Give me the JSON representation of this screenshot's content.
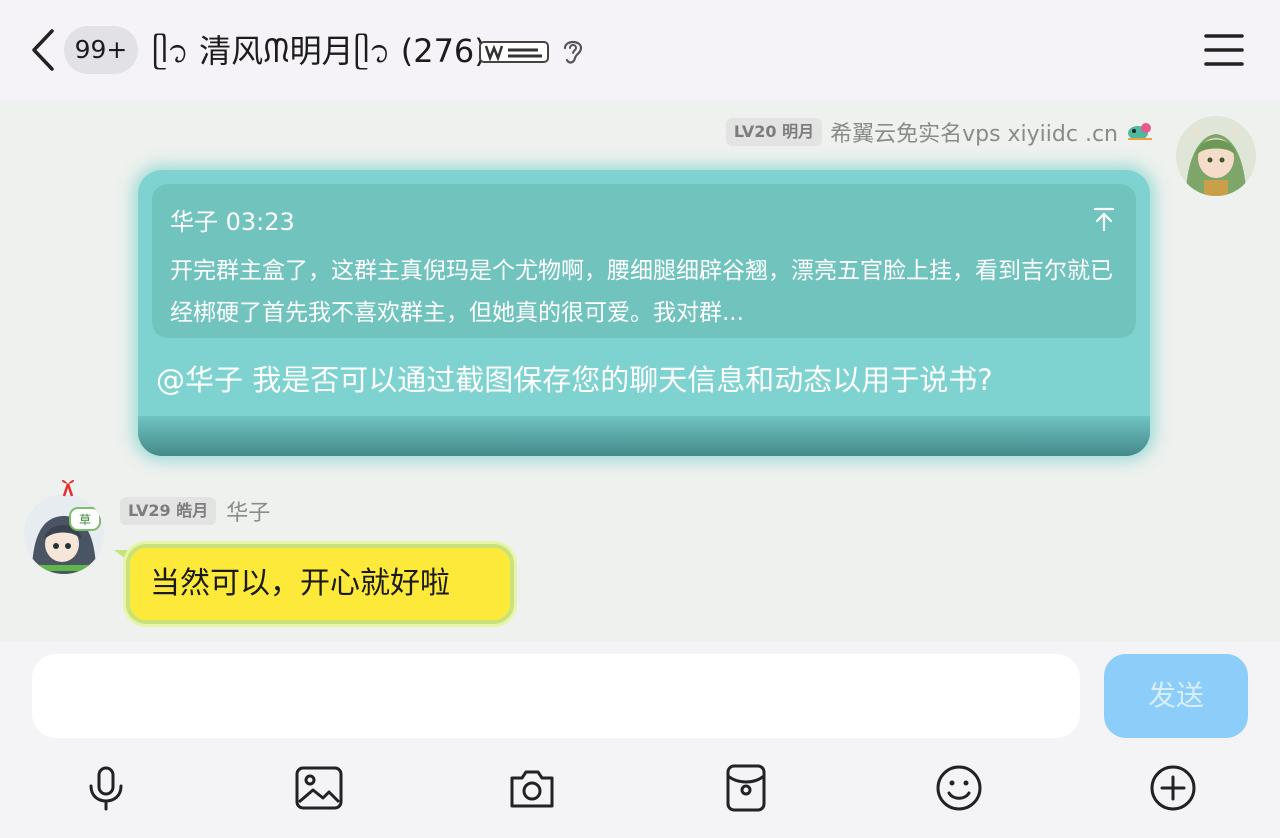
{
  "header": {
    "back_icon": "chevron-left-icon",
    "unread_badge": "99+",
    "group_title": "ᥫ᭡ 清风ᙏ明月ᥫ᭡ (276)",
    "title_badge_icon": "winner-badge-icon",
    "ear_icon": "ear-icon",
    "menu_icon": "hamburger-menu-icon"
  },
  "messages": {
    "mine": {
      "level_tag": "LV20 明月",
      "nickname": "希翼云免实名vps xiyiidc .cn",
      "quote": {
        "author_time": "华子 03:23",
        "text": "开完群主盒了，这群主真倪玛是个尤物啊，腰细腿细辟谷翘，漂亮五官脸上挂，看到吉尔就已经梆硬了首先我不喜欢群主，但她真的很可爱。我对群..."
      },
      "text": "@华子 我是否可以通过截图保存您的聊天信息和动态以用于说书?"
    },
    "other": {
      "level_tag": "LV29 皓月",
      "nickname": "华子",
      "text": "当然可以，开心就好啦"
    }
  },
  "input": {
    "placeholder": "",
    "send_label": "发送"
  },
  "toolbar": [
    "microphone-icon",
    "image-icon",
    "camera-icon",
    "red-packet-icon",
    "emoji-icon",
    "plus-circle-icon"
  ],
  "colors": {
    "my_bubble": "#7ed3d0",
    "other_bubble": "#fde93a",
    "send_button": "#8ccef9"
  }
}
